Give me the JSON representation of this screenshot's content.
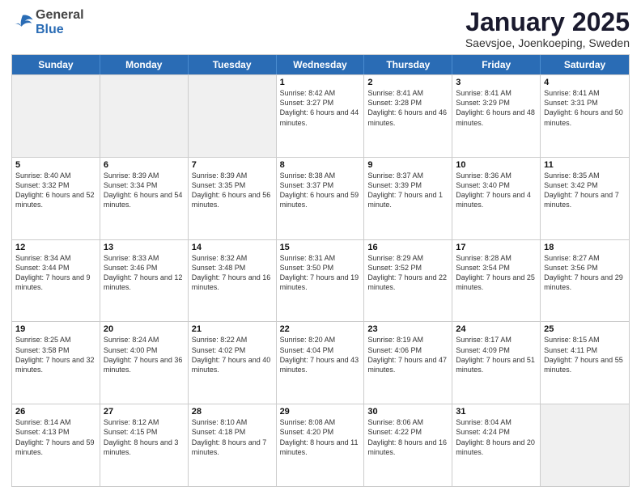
{
  "header": {
    "logo_line1": "General",
    "logo_line2": "Blue",
    "title": "January 2025",
    "subtitle": "Saevsjoe, Joenkoeping, Sweden"
  },
  "weekdays": [
    "Sunday",
    "Monday",
    "Tuesday",
    "Wednesday",
    "Thursday",
    "Friday",
    "Saturday"
  ],
  "weeks": [
    [
      {
        "day": "",
        "info": ""
      },
      {
        "day": "",
        "info": ""
      },
      {
        "day": "",
        "info": ""
      },
      {
        "day": "1",
        "info": "Sunrise: 8:42 AM\nSunset: 3:27 PM\nDaylight: 6 hours\nand 44 minutes."
      },
      {
        "day": "2",
        "info": "Sunrise: 8:41 AM\nSunset: 3:28 PM\nDaylight: 6 hours\nand 46 minutes."
      },
      {
        "day": "3",
        "info": "Sunrise: 8:41 AM\nSunset: 3:29 PM\nDaylight: 6 hours\nand 48 minutes."
      },
      {
        "day": "4",
        "info": "Sunrise: 8:41 AM\nSunset: 3:31 PM\nDaylight: 6 hours\nand 50 minutes."
      }
    ],
    [
      {
        "day": "5",
        "info": "Sunrise: 8:40 AM\nSunset: 3:32 PM\nDaylight: 6 hours\nand 52 minutes."
      },
      {
        "day": "6",
        "info": "Sunrise: 8:39 AM\nSunset: 3:34 PM\nDaylight: 6 hours\nand 54 minutes."
      },
      {
        "day": "7",
        "info": "Sunrise: 8:39 AM\nSunset: 3:35 PM\nDaylight: 6 hours\nand 56 minutes."
      },
      {
        "day": "8",
        "info": "Sunrise: 8:38 AM\nSunset: 3:37 PM\nDaylight: 6 hours\nand 59 minutes."
      },
      {
        "day": "9",
        "info": "Sunrise: 8:37 AM\nSunset: 3:39 PM\nDaylight: 7 hours\nand 1 minute."
      },
      {
        "day": "10",
        "info": "Sunrise: 8:36 AM\nSunset: 3:40 PM\nDaylight: 7 hours\nand 4 minutes."
      },
      {
        "day": "11",
        "info": "Sunrise: 8:35 AM\nSunset: 3:42 PM\nDaylight: 7 hours\nand 7 minutes."
      }
    ],
    [
      {
        "day": "12",
        "info": "Sunrise: 8:34 AM\nSunset: 3:44 PM\nDaylight: 7 hours\nand 9 minutes."
      },
      {
        "day": "13",
        "info": "Sunrise: 8:33 AM\nSunset: 3:46 PM\nDaylight: 7 hours\nand 12 minutes."
      },
      {
        "day": "14",
        "info": "Sunrise: 8:32 AM\nSunset: 3:48 PM\nDaylight: 7 hours\nand 16 minutes."
      },
      {
        "day": "15",
        "info": "Sunrise: 8:31 AM\nSunset: 3:50 PM\nDaylight: 7 hours\nand 19 minutes."
      },
      {
        "day": "16",
        "info": "Sunrise: 8:29 AM\nSunset: 3:52 PM\nDaylight: 7 hours\nand 22 minutes."
      },
      {
        "day": "17",
        "info": "Sunrise: 8:28 AM\nSunset: 3:54 PM\nDaylight: 7 hours\nand 25 minutes."
      },
      {
        "day": "18",
        "info": "Sunrise: 8:27 AM\nSunset: 3:56 PM\nDaylight: 7 hours\nand 29 minutes."
      }
    ],
    [
      {
        "day": "19",
        "info": "Sunrise: 8:25 AM\nSunset: 3:58 PM\nDaylight: 7 hours\nand 32 minutes."
      },
      {
        "day": "20",
        "info": "Sunrise: 8:24 AM\nSunset: 4:00 PM\nDaylight: 7 hours\nand 36 minutes."
      },
      {
        "day": "21",
        "info": "Sunrise: 8:22 AM\nSunset: 4:02 PM\nDaylight: 7 hours\nand 40 minutes."
      },
      {
        "day": "22",
        "info": "Sunrise: 8:20 AM\nSunset: 4:04 PM\nDaylight: 7 hours\nand 43 minutes."
      },
      {
        "day": "23",
        "info": "Sunrise: 8:19 AM\nSunset: 4:06 PM\nDaylight: 7 hours\nand 47 minutes."
      },
      {
        "day": "24",
        "info": "Sunrise: 8:17 AM\nSunset: 4:09 PM\nDaylight: 7 hours\nand 51 minutes."
      },
      {
        "day": "25",
        "info": "Sunrise: 8:15 AM\nSunset: 4:11 PM\nDaylight: 7 hours\nand 55 minutes."
      }
    ],
    [
      {
        "day": "26",
        "info": "Sunrise: 8:14 AM\nSunset: 4:13 PM\nDaylight: 7 hours\nand 59 minutes."
      },
      {
        "day": "27",
        "info": "Sunrise: 8:12 AM\nSunset: 4:15 PM\nDaylight: 8 hours\nand 3 minutes."
      },
      {
        "day": "28",
        "info": "Sunrise: 8:10 AM\nSunset: 4:18 PM\nDaylight: 8 hours\nand 7 minutes."
      },
      {
        "day": "29",
        "info": "Sunrise: 8:08 AM\nSunset: 4:20 PM\nDaylight: 8 hours\nand 11 minutes."
      },
      {
        "day": "30",
        "info": "Sunrise: 8:06 AM\nSunset: 4:22 PM\nDaylight: 8 hours\nand 16 minutes."
      },
      {
        "day": "31",
        "info": "Sunrise: 8:04 AM\nSunset: 4:24 PM\nDaylight: 8 hours\nand 20 minutes."
      },
      {
        "day": "",
        "info": ""
      }
    ]
  ]
}
